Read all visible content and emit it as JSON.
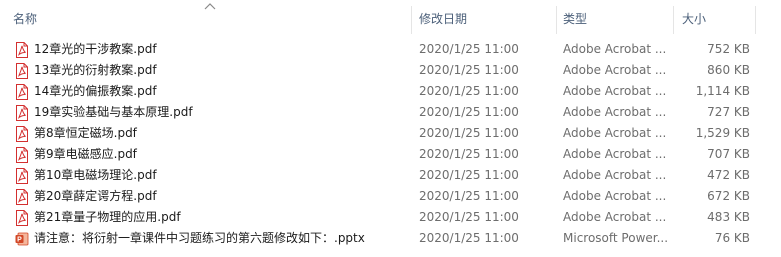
{
  "columns": {
    "name": "名称",
    "date": "修改日期",
    "type": "类型",
    "size": "大小"
  },
  "sort": {
    "column": "name",
    "direction": "ascending"
  },
  "colors": {
    "pdf_icon": "#d32f2f",
    "pptx_icon": "#d24726",
    "header_text": "#4c607a"
  },
  "files": [
    {
      "name": "12章光的干涉教案.pdf",
      "date": "2020/1/25 11:00",
      "type": "Adobe Acrobat ...",
      "size": "752 KB",
      "icon": "pdf-icon"
    },
    {
      "name": "13章光的衍射教案.pdf",
      "date": "2020/1/25 11:00",
      "type": "Adobe Acrobat ...",
      "size": "860 KB",
      "icon": "pdf-icon"
    },
    {
      "name": "14章光的偏振教案.pdf",
      "date": "2020/1/25 11:00",
      "type": "Adobe Acrobat ...",
      "size": "1,114 KB",
      "icon": "pdf-icon"
    },
    {
      "name": "19章实验基础与基本原理.pdf",
      "date": "2020/1/25 11:00",
      "type": "Adobe Acrobat ...",
      "size": "727 KB",
      "icon": "pdf-icon"
    },
    {
      "name": "第8章恒定磁场.pdf",
      "date": "2020/1/25 11:00",
      "type": "Adobe Acrobat ...",
      "size": "1,529 KB",
      "icon": "pdf-icon"
    },
    {
      "name": "第9章电磁感应.pdf",
      "date": "2020/1/25 11:00",
      "type": "Adobe Acrobat ...",
      "size": "707 KB",
      "icon": "pdf-icon"
    },
    {
      "name": "第10章电磁场理论.pdf",
      "date": "2020/1/25 11:00",
      "type": "Adobe Acrobat ...",
      "size": "472 KB",
      "icon": "pdf-icon"
    },
    {
      "name": "第20章薛定谔方程.pdf",
      "date": "2020/1/25 11:00",
      "type": "Adobe Acrobat ...",
      "size": "672 KB",
      "icon": "pdf-icon"
    },
    {
      "name": "第21章量子物理的应用.pdf",
      "date": "2020/1/25 11:00",
      "type": "Adobe Acrobat ...",
      "size": "483 KB",
      "icon": "pdf-icon"
    },
    {
      "name": "请注意：将衍射一章课件中习题练习的第六题修改如下：.pptx",
      "date": "2020/1/25 11:00",
      "type": "Microsoft Power...",
      "size": "76 KB",
      "icon": "pptx-icon"
    }
  ]
}
